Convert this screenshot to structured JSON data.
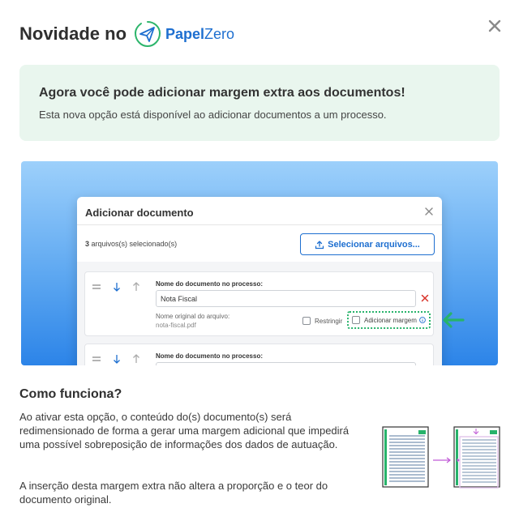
{
  "header": {
    "title": "Novidade no",
    "brand_papel": "Papel",
    "brand_zero": "Zero",
    "brand_color": "#1e6fd0",
    "logo_icon": "paper-plane-icon",
    "close_icon": "close-icon"
  },
  "banner": {
    "title": "Agora você pode adicionar margem extra aos documentos!",
    "text": "Esta nova opção está disponível ao adicionar documentos a um processo.",
    "background": "#e9f6ee"
  },
  "dialog": {
    "title": "Adicionar documento",
    "selected_count": "3",
    "selected_text": " arquivos(s) selecionado(s)",
    "select_button": "Selecionar arquivos...",
    "rows": [
      {
        "field_label": "Nome do documento no processo:",
        "field_value": "Nota Fiscal",
        "original_label": "Nome original do arquivo:",
        "original_value": "nota-fiscal.pdf",
        "restrict_label": "Restringir",
        "margin_label": "Adicionar margem"
      },
      {
        "field_label": "Nome do documento no processo:"
      }
    ]
  },
  "how": {
    "title": "Como funciona?",
    "p1": "Ao ativar esta opção, o conteúdo do(s) documento(s) será redimensionado de forma a gerar uma margem adicional que impedirá uma possível sobreposição de informações dos dados de autuação.",
    "p2": "A inserção desta margem extra não altera a proporção e o teor do documento original."
  },
  "colors": {
    "accent_green": "#27b36b",
    "accent_purple": "#c05ad6"
  }
}
